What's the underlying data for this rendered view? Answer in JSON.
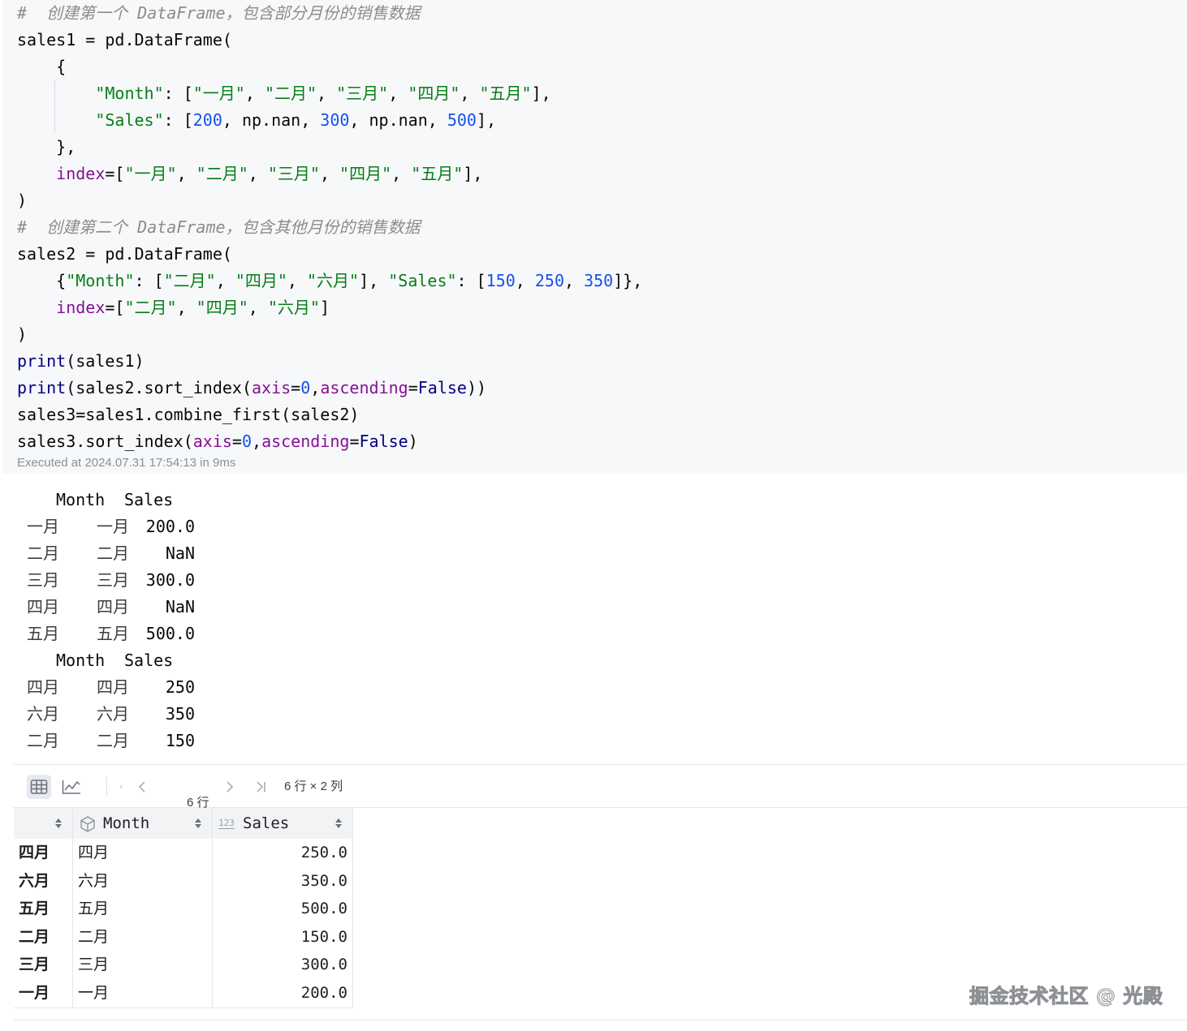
{
  "code": {
    "lines": [
      [
        {
          "t": "#  创建第一个 DataFrame，包含部分月份的销售数据",
          "k": "comment"
        }
      ],
      [
        {
          "t": "sales1 = pd.DataFrame(",
          "k": "plain"
        }
      ],
      [
        {
          "t": "    {",
          "k": "plain"
        }
      ],
      [
        {
          "t": "        ",
          "k": "plain"
        },
        {
          "t": "\"Month\"",
          "k": "string"
        },
        {
          "t": ": [",
          "k": "plain"
        },
        {
          "t": "\"一月\"",
          "k": "string"
        },
        {
          "t": ", ",
          "k": "plain"
        },
        {
          "t": "\"二月\"",
          "k": "string"
        },
        {
          "t": ", ",
          "k": "plain"
        },
        {
          "t": "\"三月\"",
          "k": "string"
        },
        {
          "t": ", ",
          "k": "plain"
        },
        {
          "t": "\"四月\"",
          "k": "string"
        },
        {
          "t": ", ",
          "k": "plain"
        },
        {
          "t": "\"五月\"",
          "k": "string"
        },
        {
          "t": "],",
          "k": "plain"
        }
      ],
      [
        {
          "t": "        ",
          "k": "plain"
        },
        {
          "t": "\"Sales\"",
          "k": "string"
        },
        {
          "t": ": [",
          "k": "plain"
        },
        {
          "t": "200",
          "k": "number"
        },
        {
          "t": ", np.nan, ",
          "k": "plain"
        },
        {
          "t": "300",
          "k": "number"
        },
        {
          "t": ", np.nan, ",
          "k": "plain"
        },
        {
          "t": "500",
          "k": "number"
        },
        {
          "t": "],",
          "k": "plain"
        }
      ],
      [
        {
          "t": "    },",
          "k": "plain"
        }
      ],
      [
        {
          "t": "    ",
          "k": "plain"
        },
        {
          "t": "index",
          "k": "kw"
        },
        {
          "t": "=[",
          "k": "plain"
        },
        {
          "t": "\"一月\"",
          "k": "string"
        },
        {
          "t": ", ",
          "k": "plain"
        },
        {
          "t": "\"二月\"",
          "k": "string"
        },
        {
          "t": ", ",
          "k": "plain"
        },
        {
          "t": "\"三月\"",
          "k": "string"
        },
        {
          "t": ", ",
          "k": "plain"
        },
        {
          "t": "\"四月\"",
          "k": "string"
        },
        {
          "t": ", ",
          "k": "plain"
        },
        {
          "t": "\"五月\"",
          "k": "string"
        },
        {
          "t": "],",
          "k": "plain"
        }
      ],
      [
        {
          "t": ")",
          "k": "plain"
        }
      ],
      [
        {
          "t": "#  创建第二个 DataFrame，包含其他月份的销售数据",
          "k": "comment"
        }
      ],
      [
        {
          "t": "sales2 = pd.DataFrame(",
          "k": "plain"
        }
      ],
      [
        {
          "t": "    {",
          "k": "plain"
        },
        {
          "t": "\"Month\"",
          "k": "string"
        },
        {
          "t": ": [",
          "k": "plain"
        },
        {
          "t": "\"二月\"",
          "k": "string"
        },
        {
          "t": ", ",
          "k": "plain"
        },
        {
          "t": "\"四月\"",
          "k": "string"
        },
        {
          "t": ", ",
          "k": "plain"
        },
        {
          "t": "\"六月\"",
          "k": "string"
        },
        {
          "t": "], ",
          "k": "plain"
        },
        {
          "t": "\"Sales\"",
          "k": "string"
        },
        {
          "t": ": [",
          "k": "plain"
        },
        {
          "t": "150",
          "k": "number"
        },
        {
          "t": ", ",
          "k": "plain"
        },
        {
          "t": "250",
          "k": "number"
        },
        {
          "t": ", ",
          "k": "plain"
        },
        {
          "t": "350",
          "k": "number"
        },
        {
          "t": "]},",
          "k": "plain"
        }
      ],
      [
        {
          "t": "    ",
          "k": "plain"
        },
        {
          "t": "index",
          "k": "kw"
        },
        {
          "t": "=[",
          "k": "plain"
        },
        {
          "t": "\"二月\"",
          "k": "string"
        },
        {
          "t": ", ",
          "k": "plain"
        },
        {
          "t": "\"四月\"",
          "k": "string"
        },
        {
          "t": ", ",
          "k": "plain"
        },
        {
          "t": "\"六月\"",
          "k": "string"
        },
        {
          "t": "]",
          "k": "plain"
        }
      ],
      [
        {
          "t": ")",
          "k": "plain"
        }
      ],
      [
        {
          "t": "print",
          "k": "builtin"
        },
        {
          "t": "(sales1)",
          "k": "plain"
        }
      ],
      [
        {
          "t": "print",
          "k": "builtin"
        },
        {
          "t": "(sales2.sort_index(",
          "k": "plain"
        },
        {
          "t": "axis",
          "k": "kw"
        },
        {
          "t": "=",
          "k": "plain"
        },
        {
          "t": "0",
          "k": "number"
        },
        {
          "t": ",",
          "k": "plain"
        },
        {
          "t": "ascending",
          "k": "kw"
        },
        {
          "t": "=",
          "k": "plain"
        },
        {
          "t": "False",
          "k": "builtin"
        },
        {
          "t": "))",
          "k": "plain"
        }
      ],
      [
        {
          "t": "sales3=sales1.combine_first(sales2)",
          "k": "plain"
        }
      ],
      [
        {
          "t": "sales3.sort_index(",
          "k": "plain"
        },
        {
          "t": "axis",
          "k": "kw"
        },
        {
          "t": "=",
          "k": "plain"
        },
        {
          "t": "0",
          "k": "number"
        },
        {
          "t": ",",
          "k": "plain"
        },
        {
          "t": "ascending",
          "k": "kw"
        },
        {
          "t": "=",
          "k": "plain"
        },
        {
          "t": "False",
          "k": "builtin"
        },
        {
          "t": ")",
          "k": "plain"
        }
      ]
    ],
    "exec_info": "Executed at 2024.07.31 17:54:13 in 9ms"
  },
  "output": {
    "blocks": [
      {
        "columns": [
          "Month",
          "Sales"
        ],
        "rows": [
          {
            "index": "一月",
            "month": "一月",
            "sales": "200.0"
          },
          {
            "index": "二月",
            "month": "二月",
            "sales": "NaN"
          },
          {
            "index": "三月",
            "month": "三月",
            "sales": "300.0"
          },
          {
            "index": "四月",
            "month": "四月",
            "sales": "NaN"
          },
          {
            "index": "五月",
            "month": "五月",
            "sales": "500.0"
          }
        ]
      },
      {
        "columns": [
          "Month",
          "Sales"
        ],
        "rows": [
          {
            "index": "四月",
            "month": "四月",
            "sales": "250"
          },
          {
            "index": "六月",
            "month": "六月",
            "sales": "350"
          },
          {
            "index": "二月",
            "month": "二月",
            "sales": "150"
          }
        ]
      }
    ]
  },
  "dataframe_viewer": {
    "toolbar": {
      "rows_selector": "6 行",
      "shape": "6 行 × 2 列"
    },
    "columns": [
      {
        "label": "Month",
        "type_icon": "cube-icon"
      },
      {
        "label": "Sales",
        "type_icon": "number-type-icon",
        "type_badge": "123"
      }
    ],
    "rows": [
      {
        "index": "四月",
        "month": "四月",
        "sales": "250.0"
      },
      {
        "index": "六月",
        "month": "六月",
        "sales": "350.0"
      },
      {
        "index": "五月",
        "month": "五月",
        "sales": "500.0"
      },
      {
        "index": "二月",
        "month": "二月",
        "sales": "150.0"
      },
      {
        "index": "三月",
        "month": "三月",
        "sales": "300.0"
      },
      {
        "index": "一月",
        "month": "一月",
        "sales": "200.0"
      }
    ]
  },
  "watermark": "掘金技术社区 @ 光殿",
  "colors": {
    "code_background": "#f7f8fa",
    "string": "#067d17",
    "number": "#1750eb",
    "keyword_arg": "#871094",
    "builtin": "#000080",
    "comment": "#8c8c8c"
  }
}
